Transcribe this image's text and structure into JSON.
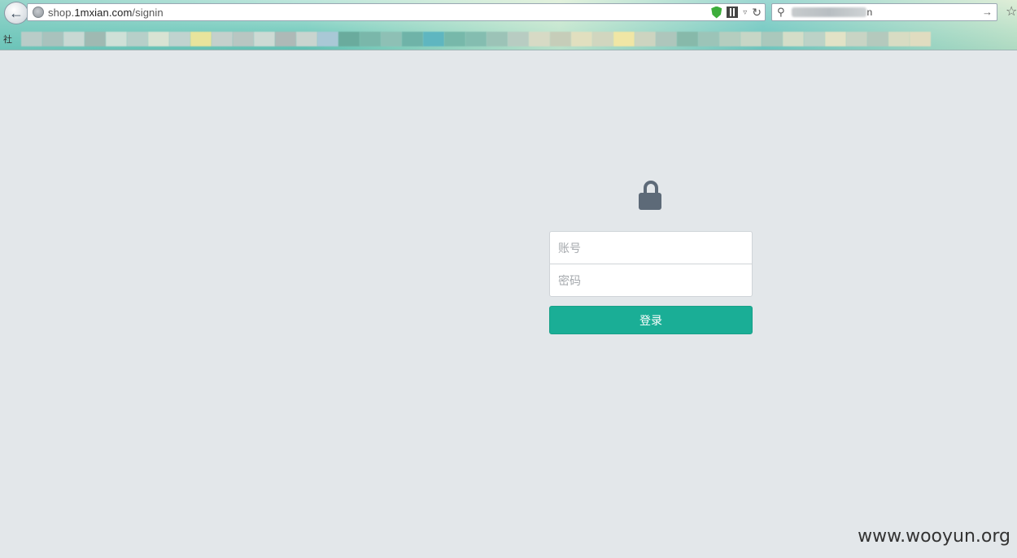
{
  "browser": {
    "url_prefix": "shop.",
    "url_host": "1mxian.com",
    "url_path": "/signin",
    "search_suffix": "n",
    "bookmark_glyph": "社",
    "accent_shield_color": "#3dad3b"
  },
  "login": {
    "username_placeholder": "账号",
    "password_placeholder": "密码",
    "submit_label": "登录",
    "lock_color": "#5d6a78",
    "button_color": "#1aae96"
  },
  "watermark": "www.wooyun.org"
}
